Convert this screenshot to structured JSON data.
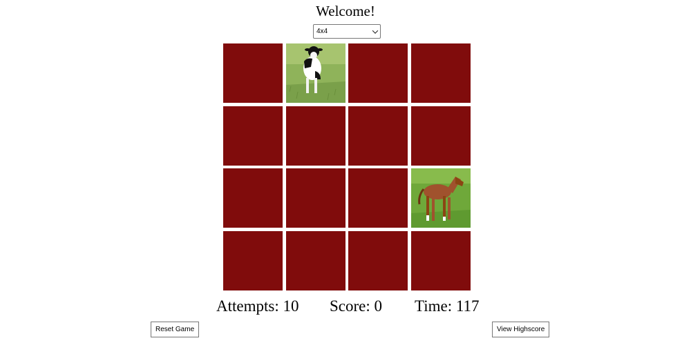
{
  "header": {
    "title": "Welcome!"
  },
  "board_size_select": {
    "selected": "4x4"
  },
  "board": {
    "rows": 4,
    "cols": 4,
    "cards": [
      {
        "state": "face-down"
      },
      {
        "state": "face-up",
        "image": "cow"
      },
      {
        "state": "face-down"
      },
      {
        "state": "face-down"
      },
      {
        "state": "face-down"
      },
      {
        "state": "face-down"
      },
      {
        "state": "face-down"
      },
      {
        "state": "face-down"
      },
      {
        "state": "face-down"
      },
      {
        "state": "face-down"
      },
      {
        "state": "face-down"
      },
      {
        "state": "face-up",
        "image": "horse"
      },
      {
        "state": "face-down"
      },
      {
        "state": "face-down"
      },
      {
        "state": "face-down"
      },
      {
        "state": "face-down"
      }
    ],
    "card_back_color": "#800c0c"
  },
  "stats": {
    "attempts_label": "Attempts:",
    "attempts": "10",
    "score_label": "Score:",
    "score": "0",
    "time_label": "Time:",
    "time": "117"
  },
  "buttons": {
    "reset": "Reset Game",
    "highscore": "View Highscore"
  }
}
